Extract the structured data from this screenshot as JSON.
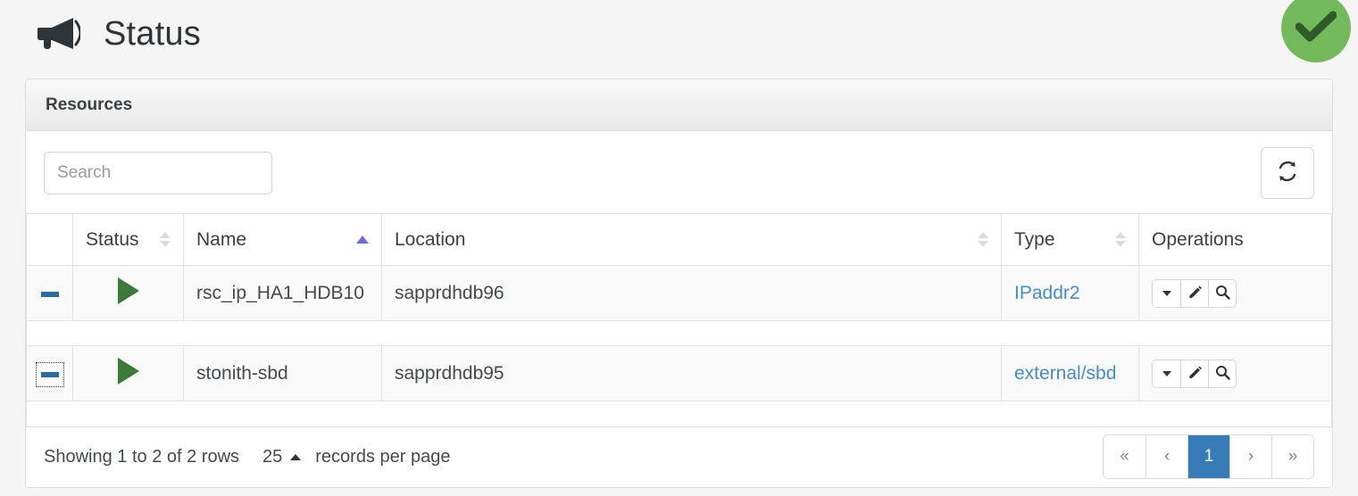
{
  "header": {
    "icon": "megaphone-icon",
    "title": "Status",
    "health_badge": {
      "icon": "check-circle-icon",
      "circle_color": "#74b95b",
      "check_color": "#2d5c28"
    }
  },
  "panel": {
    "title": "Resources",
    "toolbar": {
      "search_placeholder": "Search",
      "search_value": "",
      "refresh_icon": "refresh-icon"
    },
    "table": {
      "columns": [
        {
          "label": "",
          "sort": "none"
        },
        {
          "label": "Status",
          "sort": "both"
        },
        {
          "label": "Name",
          "sort": "asc"
        },
        {
          "label": "Location",
          "sort": "both"
        },
        {
          "label": "Type",
          "sort": "both"
        },
        {
          "label": "Operations",
          "sort": "none"
        }
      ],
      "rows": [
        {
          "toggle": {
            "icon": "minus-icon",
            "focused": false
          },
          "status": {
            "icon": "play-icon",
            "color": "#3b7a3b"
          },
          "name": "rsc_ip_HA1_HDB10",
          "location": "sapprdhdb96",
          "type": "IPaddr2",
          "operations": [
            "caret-down-icon",
            "pencil-icon",
            "magnifier-icon"
          ]
        },
        {
          "toggle": {
            "icon": "minus-icon",
            "focused": true
          },
          "status": {
            "icon": "play-icon",
            "color": "#3b7a3b"
          },
          "name": "stonith-sbd",
          "location": "sapprdhdb95",
          "type": "external/sbd",
          "operations": [
            "caret-down-icon",
            "pencil-icon",
            "magnifier-icon"
          ]
        }
      ]
    },
    "footer": {
      "rows_info": "Showing 1 to 2 of 2 rows",
      "page_size": "25",
      "per_page_label": "records per page",
      "pagination": {
        "first": "«",
        "prev": "‹",
        "pages": [
          "1"
        ],
        "active_page": "1",
        "next": "›",
        "last": "»"
      }
    }
  },
  "colors": {
    "page_bg": "#f5f5f5",
    "link": "#4a8cc4",
    "active_page": "#377cb8",
    "toggle_blue": "#2f6a9b",
    "sort_active": "#6b6fd4"
  }
}
